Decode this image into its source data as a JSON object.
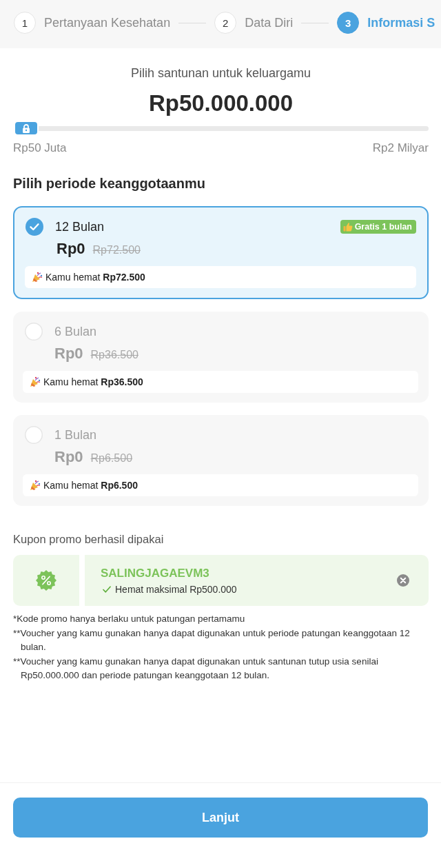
{
  "steps": [
    {
      "number": "1",
      "label": "Pertanyaan Kesehatan",
      "selected": false
    },
    {
      "number": "2",
      "label": "Data Diri",
      "selected": false
    },
    {
      "number": "3",
      "label": "Informasi S",
      "selected": true
    }
  ],
  "benefit": {
    "prompt": "Pilih santunan untuk keluargamu",
    "amount": "Rp50.000.000",
    "slider": {
      "level": 0,
      "locked": true
    },
    "min_label": "Rp50 Juta",
    "max_label": "Rp2 Milyar"
  },
  "period_section": {
    "title": "Pilih periode keanggotaanmu",
    "options": [
      {
        "label": "12 Bulan",
        "selected": true,
        "badge": "Gratis 1 bulan",
        "price": "Rp0",
        "original_price": "Rp72.500",
        "savings": "Kamu hemat **Rp72.500**"
      },
      {
        "label": "6 Bulan",
        "selected": false,
        "price": "Rp0",
        "original_price": "Rp36.500",
        "savings": "Kamu hemat **Rp36.500**"
      },
      {
        "label": "1 Bulan",
        "selected": false,
        "price": "Rp0",
        "original_price": "Rp6.500",
        "savings": "Kamu hemat **Rp6.500**"
      }
    ]
  },
  "coupon": {
    "title": "Kupon promo berhasil dipakai",
    "code": "SALINGJAGAEVM3",
    "note": "Hemat maksimal Rp500.000"
  },
  "footnotes": [
    "*Kode promo hanya berlaku untuk patungan pertamamu",
    "**Voucher yang kamu gunakan hanya dapat digunakan untuk periode patungan keanggotaan 12 bulan.",
    "**Voucher yang kamu gunakan hanya dapat digunakan untuk santunan tutup usia senilai Rp50.000.000 dan periode patungan keanggotaan 12 bulan."
  ],
  "button": {
    "label": "Lanjut"
  }
}
